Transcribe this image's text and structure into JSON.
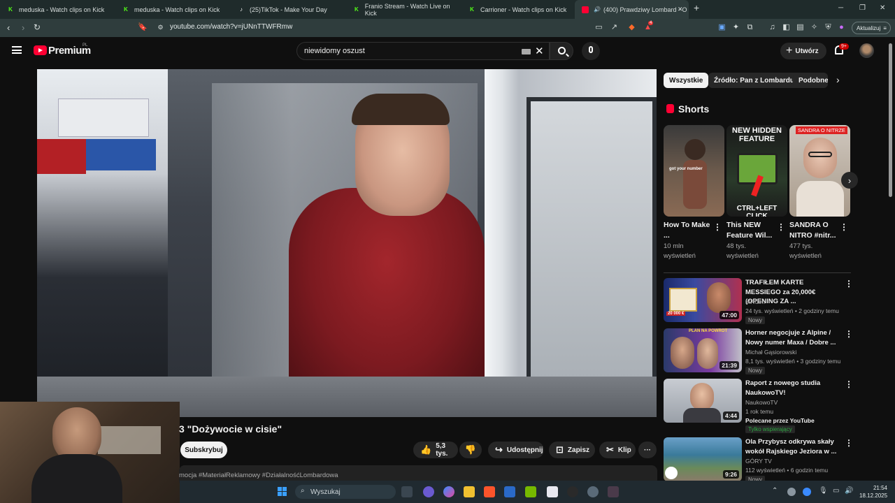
{
  "browser": {
    "tabs": [
      {
        "title": "meduska - Watch clips on Kick",
        "icon": "kick-icon"
      },
      {
        "title": "meduska - Watch clips on Kick",
        "icon": "kick-icon"
      },
      {
        "title": "(25)TikTok - Make Your Day",
        "icon": "tiktok-icon"
      },
      {
        "title": "Franio Stream - Watch Live on Kick",
        "icon": "kick-icon"
      },
      {
        "title": "Carrioner - Watch clips on Kick",
        "icon": "kick-icon"
      },
      {
        "title": "(400) Prawdziwy Lombard - O",
        "icon": "youtube-icon"
      }
    ],
    "new_tab": "+",
    "window_controls": {
      "minimize": "─",
      "maximize": "❐",
      "close": "✕"
    },
    "tab_close": "✕",
    "url": "youtube.com/watch?v=jUNnTTWFRmw",
    "extension_badge": "4",
    "update_button": "Aktualizuj"
  },
  "youtube": {
    "brand": "Premium",
    "region": "PL",
    "search_query": "niewidomy oszust",
    "create_label": "Utwórz",
    "notif_count": "9+",
    "video": {
      "title": "3 \"Dożywocie w cisie\"",
      "subscribe_label": "Subskrybuj",
      "likes": "5,3 tys.",
      "share_label": "Udostępnij",
      "save_label": "Zapisz",
      "clip_label": "Klip",
      "more": "···",
      "description": "mocja #MateriałReklamowy #DziałalnośćLombardowa"
    },
    "chips": [
      "Wszystkie",
      "Źródło: Pan z Lombardu",
      "Podobne"
    ],
    "shorts_heading": "Shorts",
    "shorts": [
      {
        "title": "How To Make ...",
        "views": "10 mln wyświetleń",
        "overlay": "got your number"
      },
      {
        "title": "This NEW Feature Wil...",
        "views": "48 tys. wyświetleń",
        "overlay_top": "NEW HIDDEN FEATURE",
        "overlay_bottom": "CTRL+LEFT CLICK"
      },
      {
        "title": "SANDRA O NITRO #nitr...",
        "views": "477 tys. wyświetleń",
        "overlay_top": "SANDRA O NITRZE"
      }
    ],
    "recommendations": [
      {
        "title": "TRAFIŁEM KARTE MESSIEGO za 20,000€ (OPENING ZA ...",
        "channel": "MRGH.",
        "meta": "24 tys. wyświetleń • 2 godziny temu",
        "badge": "Nowy",
        "duration": "47:00",
        "thumb_text": "20 000 €"
      },
      {
        "title": "Horner negocjuje z Alpine / Nowy numer Maxa / Dobre ...",
        "channel": "Michał Gąsiorowski",
        "meta": "8,1 tys. wyświetleń • 3 godziny temu",
        "badge": "Nowy",
        "duration": "21:39",
        "thumb_text": "PLAN NA POWRÓT"
      },
      {
        "title": "Raport z nowego studia NaukowoTV!",
        "channel": "NaukowoTV",
        "meta": "1 rok temu",
        "extra": "Polecane przez YouTube",
        "badge": "Tylko wspierający",
        "duration": "4:44"
      },
      {
        "title": "Ola Przybysz odkrywa skały wokół Rajskiego Jeziora w ...",
        "channel": "GÓRY TV",
        "meta": "112 wyświetleń • 6 godzin temu",
        "badge": "Nowy",
        "duration": "9:26"
      }
    ]
  },
  "taskbar": {
    "search_placeholder": "Wyszukaj",
    "time": "21:54",
    "date": "18.12.2025"
  },
  "colors": {
    "kick_green": "#53fc18",
    "youtube_red": "#ff0033",
    "browser_frame": "#1f2b2b"
  }
}
